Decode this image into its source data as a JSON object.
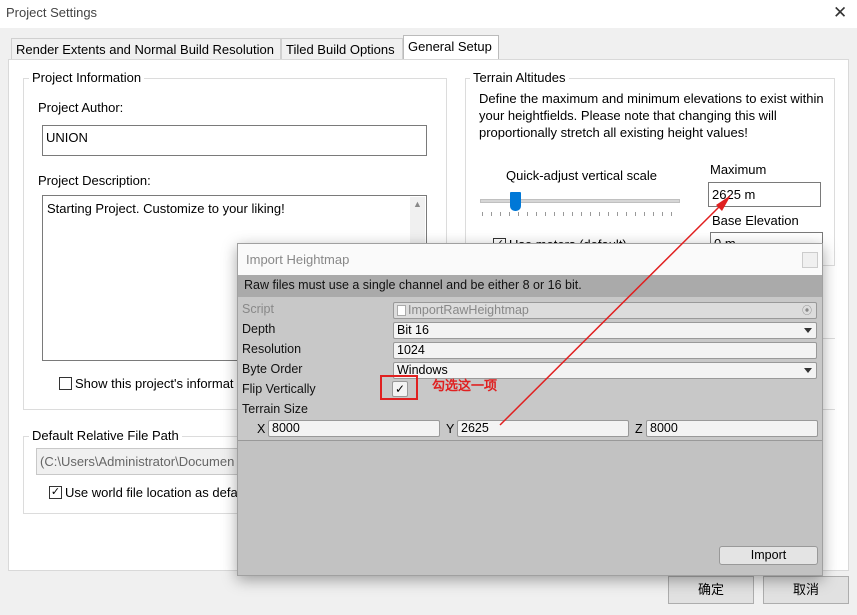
{
  "window": {
    "title": "Project Settings"
  },
  "tabs": [
    {
      "label": "Render Extents and Normal Build Resolution",
      "active": false
    },
    {
      "label": "Tiled Build Options",
      "active": false
    },
    {
      "label": "General Setup",
      "active": true
    }
  ],
  "project_info": {
    "legend": "Project Information",
    "author_label": "Project Author:",
    "author_value": "UNION",
    "description_label": "Project Description:",
    "description_value": "Starting Project. Customize to your liking!",
    "show_checkbox_label": "Show this project's informat",
    "show_checked": false
  },
  "file_path": {
    "legend": "Default Relative File Path",
    "path_value": "(C:\\Users\\Administrator\\Documen",
    "use_world_label": "Use world file location as defa",
    "use_world_checked": true
  },
  "terrain": {
    "legend": "Terrain Altitudes",
    "description": "Define the maximum and minimum elevations to exist within your heightfields. Please note that changing this will proportionally stretch all existing height values!",
    "slider_label": "Quick-adjust vertical scale",
    "maximum_label": "Maximum",
    "maximum_value": "2625 m",
    "base_label": "Base Elevation",
    "base_value": "0 m",
    "use_meters_label": "Use meters (default)",
    "use_meters_checked": true
  },
  "footer": {
    "ok_label": "确定",
    "cancel_label": "取消"
  },
  "import_dialog": {
    "title": "Import Heightmap",
    "help": "Raw files must use a single channel and be either 8 or 16 bit.",
    "fields": {
      "script_label": "Script",
      "script_value": "ImportRawHeightmap",
      "depth_label": "Depth",
      "depth_value": "Bit 16",
      "resolution_label": "Resolution",
      "resolution_value": "1024",
      "byte_order_label": "Byte Order",
      "byte_order_value": "Windows",
      "flip_label": "Flip Vertically",
      "flip_checked": true,
      "terrain_size_label": "Terrain Size",
      "x_label": "X",
      "x_value": "8000",
      "y_label": "Y",
      "y_value": "2625",
      "z_label": "Z",
      "z_value": "8000"
    },
    "import_button": "Import"
  },
  "annotation": {
    "text": "勾选这一项",
    "color": "#e02020"
  }
}
